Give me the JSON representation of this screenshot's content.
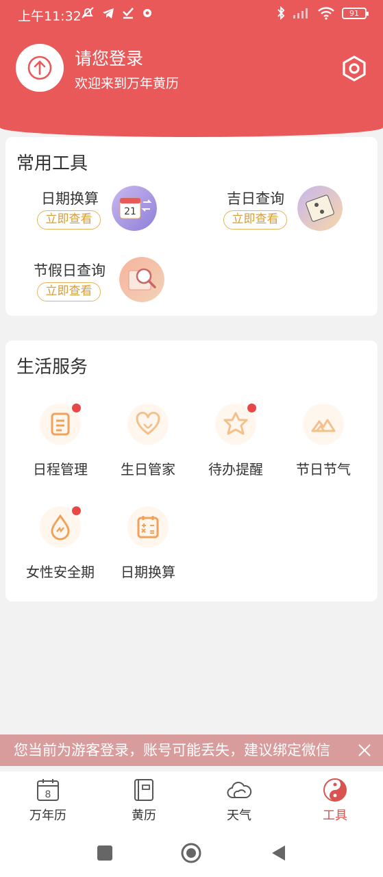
{
  "status": {
    "time": "上午11:32",
    "battery": "91"
  },
  "profile": {
    "title": "请您登录",
    "subtitle": "欢迎来到万年黄历"
  },
  "tools": {
    "title": "常用工具",
    "items": [
      {
        "name": "日期换算",
        "button": "立即查看",
        "icon": "calendar-swap-icon"
      },
      {
        "name": "吉日查询",
        "button": "立即查看",
        "icon": "scroll-icon"
      },
      {
        "name": "节假日查询",
        "button": "立即查看",
        "icon": "magnifier-scroll-icon"
      }
    ]
  },
  "services": {
    "title": "生活服务",
    "items": [
      {
        "label": "日程管理",
        "icon": "document-icon",
        "badge": true
      },
      {
        "label": "生日管家",
        "icon": "heart-icon",
        "badge": false
      },
      {
        "label": "待办提醒",
        "icon": "star-icon",
        "badge": true
      },
      {
        "label": "节日节气",
        "icon": "mountain-icon",
        "badge": false
      },
      {
        "label": "女性安全期",
        "icon": "drop-icon",
        "badge": true
      },
      {
        "label": "日期换算",
        "icon": "calculator-icon",
        "badge": false
      }
    ]
  },
  "guest_banner": {
    "text": "您当前为游客登录，账号可能丢失，建议绑定微信"
  },
  "tabbar": {
    "calendar_day": "8",
    "items": [
      {
        "label": "万年历",
        "icon": "calendar-icon",
        "active": false
      },
      {
        "label": "黄历",
        "icon": "almanac-icon",
        "active": false
      },
      {
        "label": "天气",
        "icon": "cloud-icon",
        "active": false
      },
      {
        "label": "工具",
        "icon": "yinyang-icon",
        "active": true
      }
    ]
  },
  "colors": {
    "brand": "#e9595a",
    "accent": "#e4b45c",
    "icon_orange": "#f0a25a",
    "active_tab": "#d9534f"
  }
}
